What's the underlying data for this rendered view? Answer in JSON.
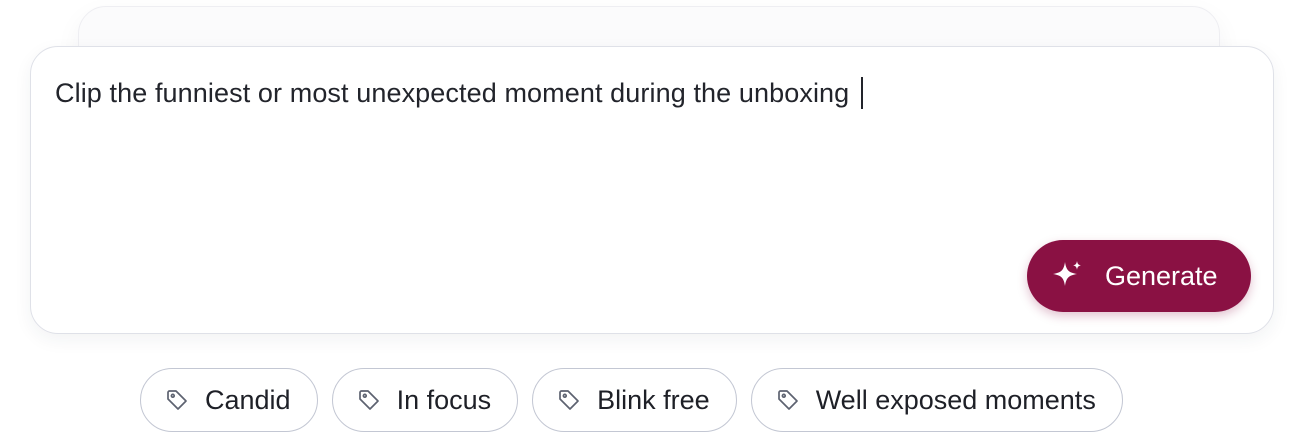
{
  "prompt": {
    "text": "Clip the funniest or most unexpected moment during the unboxing"
  },
  "generate_button": {
    "label": "Generate",
    "icon": "sparkle-icon",
    "color": "#8a1143"
  },
  "suggestions": [
    {
      "label": "Candid",
      "icon": "tag-icon"
    },
    {
      "label": "In focus",
      "icon": "tag-icon"
    },
    {
      "label": "Blink free",
      "icon": "tag-icon"
    },
    {
      "label": "Well exposed moments",
      "icon": "tag-icon"
    }
  ]
}
